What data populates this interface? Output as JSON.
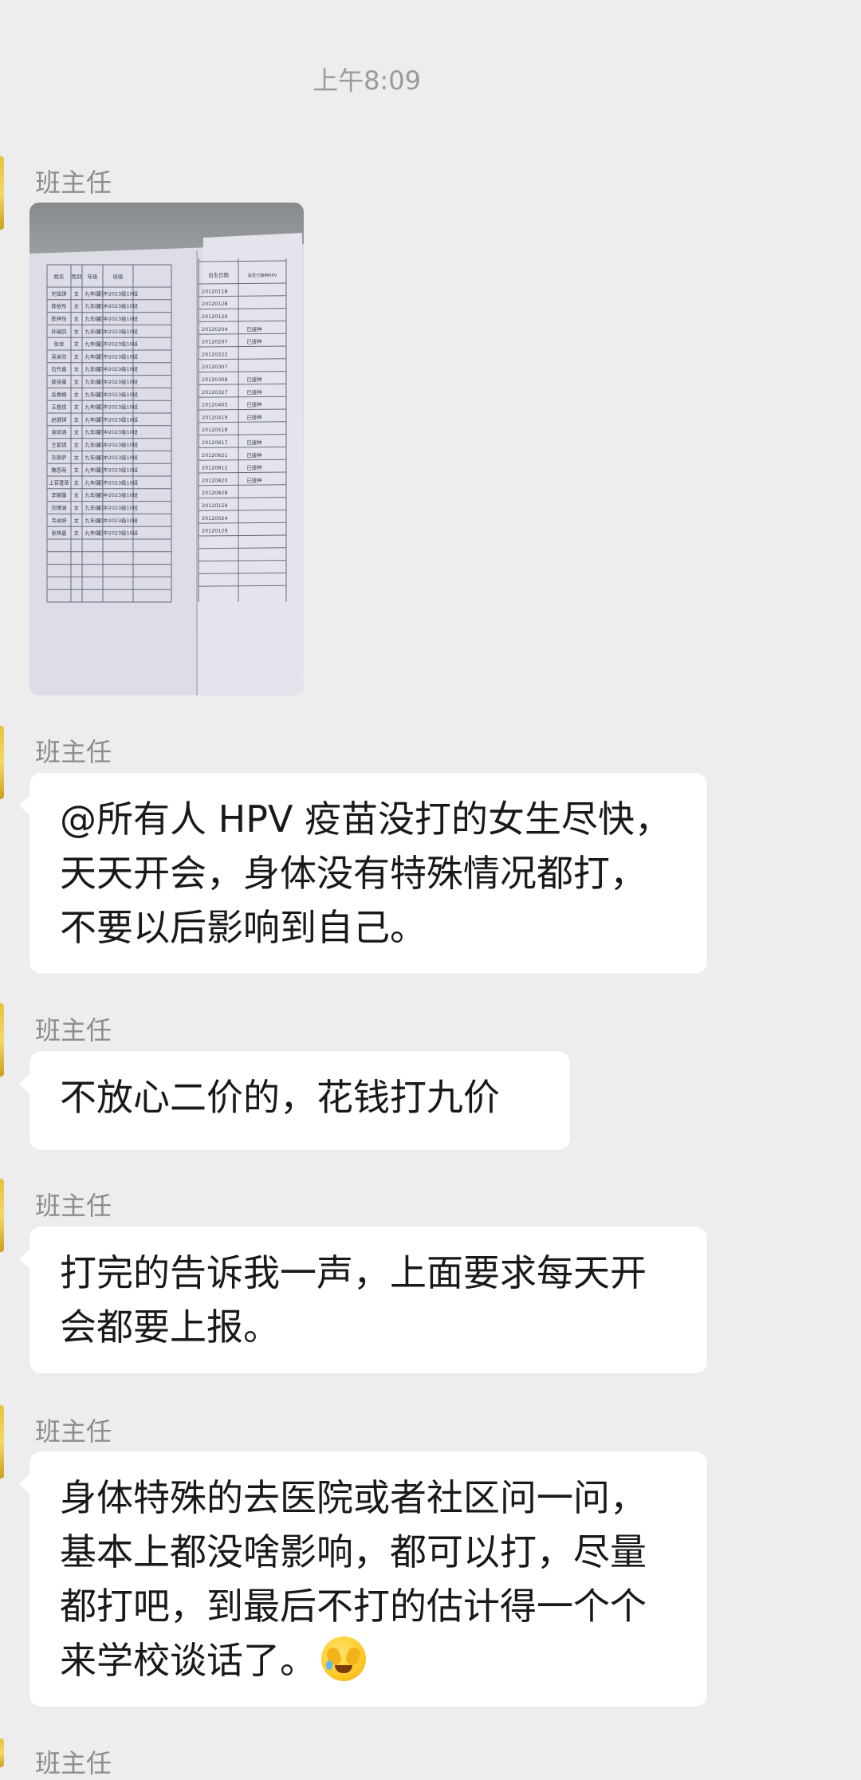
{
  "chat": {
    "timestamp": "上午8:09",
    "messages": [
      {
        "sender": "班主任",
        "type": "image"
      },
      {
        "sender": "班主任",
        "type": "text",
        "text": "@所有人  HPV 疫苗没打的女生尽快，天天开会，身体没有特殊情况都打，不要以后影响到自己。"
      },
      {
        "sender": "班主任",
        "type": "text",
        "text": "不放心二价的，花钱打九价"
      },
      {
        "sender": "班主任",
        "type": "text",
        "text": "打完的告诉我一声，上面要求每天开会都要上报。"
      },
      {
        "sender": "班主任",
        "type": "text",
        "text": "身体特殊的去医院或者社区问一问，基本上都没啥影响，都可以打，尽量都打吧，到最后不打的估计得一个个来学校谈话了。",
        "trailing_emoji": "crying-laughing-face-icon"
      },
      {
        "sender": "班主任",
        "type": "text"
      }
    ]
  },
  "photo_table": {
    "headers": [
      "姓名",
      "性别",
      "年级",
      "班级",
      "出生日期",
      "是否已接种HPV"
    ],
    "rows": [
      [
        "刘佳琪",
        "女",
        "九年级",
        "初中2023级10班",
        "20120118",
        ""
      ],
      [
        "薛依彤",
        "女",
        "九年级",
        "初中2023级10班",
        "20120128",
        ""
      ],
      [
        "陈梓怡",
        "女",
        "九年级",
        "初中2023级10班",
        "20120129",
        ""
      ],
      [
        "孙瑞鸽",
        "女",
        "九年级",
        "初中2023级10班",
        "20120204",
        "已接种"
      ],
      [
        "张佳",
        "女",
        "九年级",
        "初中2023级10班",
        "20120207",
        "已接种"
      ],
      [
        "吴美欣",
        "女",
        "九年级",
        "初中2023级10班",
        "20120222",
        ""
      ],
      [
        "石竹鑫",
        "女",
        "九年级",
        "初中2023级10班",
        "20120307",
        ""
      ],
      [
        "薛佳馨",
        "女",
        "九年级",
        "初中2023级10班",
        "20120308",
        "已接种"
      ],
      [
        "岳惠桐",
        "女",
        "九年级",
        "初中2023级10班",
        "20120327",
        "已接种"
      ],
      [
        "王鑫悦",
        "女",
        "九年级",
        "初中2023级10班",
        "20120405",
        "已接种"
      ],
      [
        "赵健琪",
        "女",
        "九年级",
        "初中2023级10班",
        "20120419",
        "已接种"
      ],
      [
        "袁硕涵",
        "女",
        "九年级",
        "初中2023级10班",
        "20120518",
        ""
      ],
      [
        "王紫琪",
        "女",
        "九年级",
        "初中2023级10班",
        "20120617",
        "已接种"
      ],
      [
        "刘美萨",
        "女",
        "九年级",
        "初中2023级10班",
        "20120621",
        "已接种"
      ],
      [
        "魏思萌",
        "女",
        "九年级",
        "初中2023级10班",
        "20120812",
        "已接种"
      ],
      [
        "上官蓬荣",
        "女",
        "九年级",
        "初中2023级10班",
        "20120820",
        "已接种"
      ],
      [
        "李娜馨",
        "女",
        "九年级",
        "初中2023级10班",
        "20120828",
        ""
      ],
      [
        "刘博涵",
        "女",
        "九年级",
        "初中2023级10班",
        "20120159",
        ""
      ],
      [
        "韦卓妍",
        "女",
        "九年级",
        "初中2023级10班",
        "20120024",
        ""
      ],
      [
        "张梓嘉",
        "女",
        "九年级",
        "初中2023级10班",
        "20120129",
        ""
      ]
    ]
  }
}
